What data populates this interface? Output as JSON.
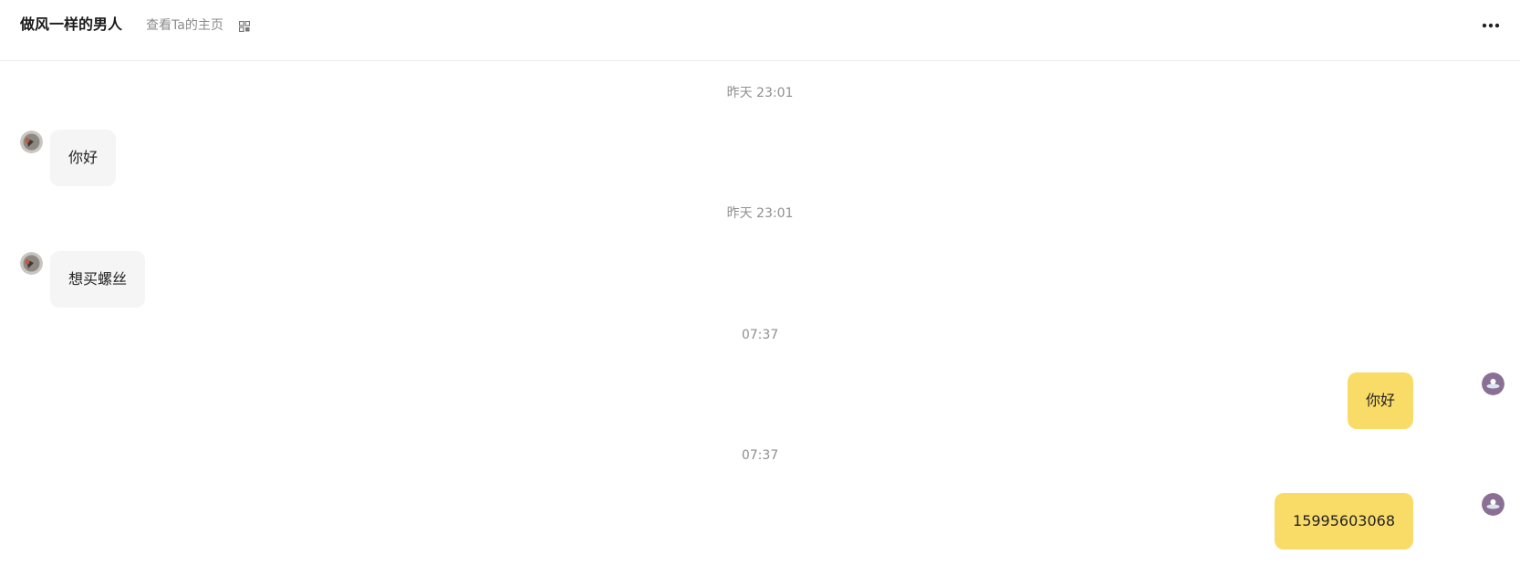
{
  "header": {
    "contact_name": "做风一样的男人",
    "profile_link_label": "查看Ta的主页",
    "qr_icon": "qr-code-icon",
    "more_icon": "more-horizontal-icon"
  },
  "messages": [
    {
      "time": "昨天 23:01",
      "sender": "contact",
      "text": "你好"
    },
    {
      "time": "昨天 23:01",
      "sender": "contact",
      "text": "想买螺丝"
    },
    {
      "time": "07:37",
      "sender": "me",
      "text": "你好"
    },
    {
      "time": "07:37",
      "sender": "me",
      "text": "15995603068"
    }
  ],
  "colors": {
    "incoming_bubble": "#f5f5f5",
    "outgoing_bubble": "#f9dc68",
    "timestamp": "#8f8f8f"
  }
}
